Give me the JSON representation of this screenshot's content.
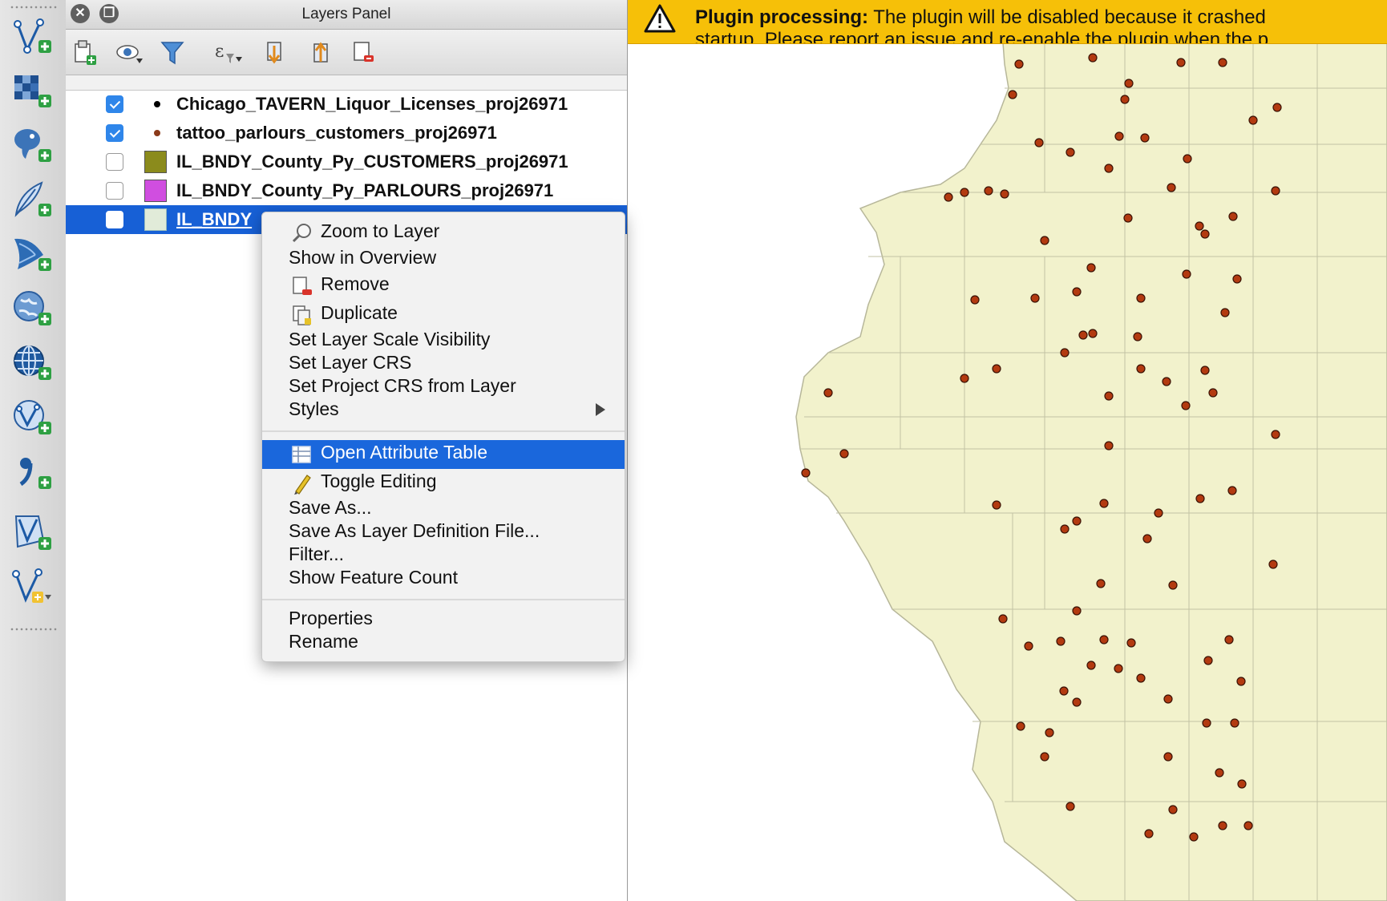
{
  "left_toolbar": {
    "tools": [
      {
        "icon": "add-delimited-text-layer-icon"
      },
      {
        "icon": "add-raster-layer-icon"
      },
      {
        "icon": "add-postgis-layer-icon"
      },
      {
        "icon": "add-spatialite-layer-icon"
      },
      {
        "icon": "add-mssql-layer-icon"
      },
      {
        "icon": "add-wms-layer-icon"
      },
      {
        "icon": "add-wcs-layer-icon"
      },
      {
        "icon": "add-wfs-layer-icon"
      },
      {
        "icon": "add-oracle-layer-icon"
      },
      {
        "icon": "add-virtual-layer-icon"
      },
      {
        "icon": "new-layer-dropdown-icon"
      }
    ]
  },
  "layers_panel": {
    "title": "Layers Panel",
    "toolbar": [
      {
        "icon": "add-group-icon"
      },
      {
        "icon": "manage-visibility-icon"
      },
      {
        "icon": "filter-legend-icon"
      },
      {
        "icon": "filter-by-expression-icon"
      },
      {
        "icon": "expand-all-icon"
      },
      {
        "icon": "collapse-all-icon"
      },
      {
        "icon": "remove-layer-icon"
      }
    ],
    "layers": [
      {
        "name": "Chicago_TAVERN_Liquor_Licenses_proj26971",
        "checked": true,
        "symbol": "point",
        "color": "#000000"
      },
      {
        "name": "tattoo_parlours_customers_proj26971",
        "checked": true,
        "symbol": "point",
        "color": "#8b3a1a"
      },
      {
        "name": "IL_BNDY_County_Py_CUSTOMERS_proj26971",
        "checked": false,
        "symbol": "polygon",
        "color": "#8b8b1c"
      },
      {
        "name": "IL_BNDY_County_Py_PARLOURS_proj26971",
        "checked": false,
        "symbol": "polygon",
        "color": "#d04ee0"
      },
      {
        "name": "IL_BNDY",
        "checked": true,
        "symbol": "polygon",
        "color": "#e1ebd9",
        "selected": true
      }
    ]
  },
  "context_menu": {
    "items": [
      {
        "label": "Zoom to Layer",
        "icon": "zoom-to-layer-icon"
      },
      {
        "label": "Show in Overview"
      },
      {
        "label": "Remove",
        "icon": "remove-icon"
      },
      {
        "label": "Duplicate",
        "icon": "duplicate-icon"
      },
      {
        "label": "Set Layer Scale Visibility"
      },
      {
        "label": "Set Layer CRS"
      },
      {
        "label": "Set Project CRS from Layer"
      },
      {
        "label": "Styles",
        "submenu": true
      },
      {
        "label": "Open Attribute Table",
        "icon": "attribute-table-icon",
        "highlighted": true
      },
      {
        "label": "Toggle Editing",
        "icon": "pencil-icon"
      },
      {
        "label": "Save As..."
      },
      {
        "label": "Save As Layer Definition File..."
      },
      {
        "label": "Filter..."
      },
      {
        "label": "Show Feature Count"
      },
      {
        "label": "Properties"
      },
      {
        "label": "Rename"
      }
    ]
  },
  "message_bar": {
    "icon": "warning-icon",
    "title": "Plugin processing:",
    "text": "The plugin will be disabled because it crashed",
    "text2": "startup. Please report an issue and re-enable the plugin when the p",
    "color": "#f6c008"
  },
  "map": {
    "fill_color": "#f2f2cc",
    "boundary_color": "#b7b79a",
    "point_color": "#b33a10"
  }
}
